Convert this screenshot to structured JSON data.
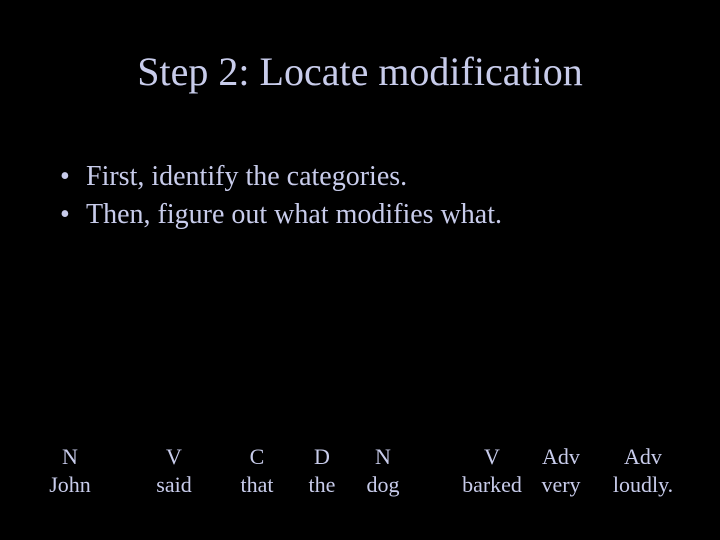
{
  "title": "Step 2: Locate modification",
  "bullets": [
    "First, identify the categories.",
    "Then, figure out what modifies what."
  ],
  "words": [
    {
      "cat": "N",
      "word": "John"
    },
    {
      "cat": "V",
      "word": "said"
    },
    {
      "cat": "C",
      "word": "that"
    },
    {
      "cat": "D",
      "word": "the"
    },
    {
      "cat": "N",
      "word": "dog"
    },
    {
      "cat": "V",
      "word": "barked"
    },
    {
      "cat": "Adv",
      "word": "very"
    },
    {
      "cat": "Adv",
      "word": "loudly."
    }
  ]
}
